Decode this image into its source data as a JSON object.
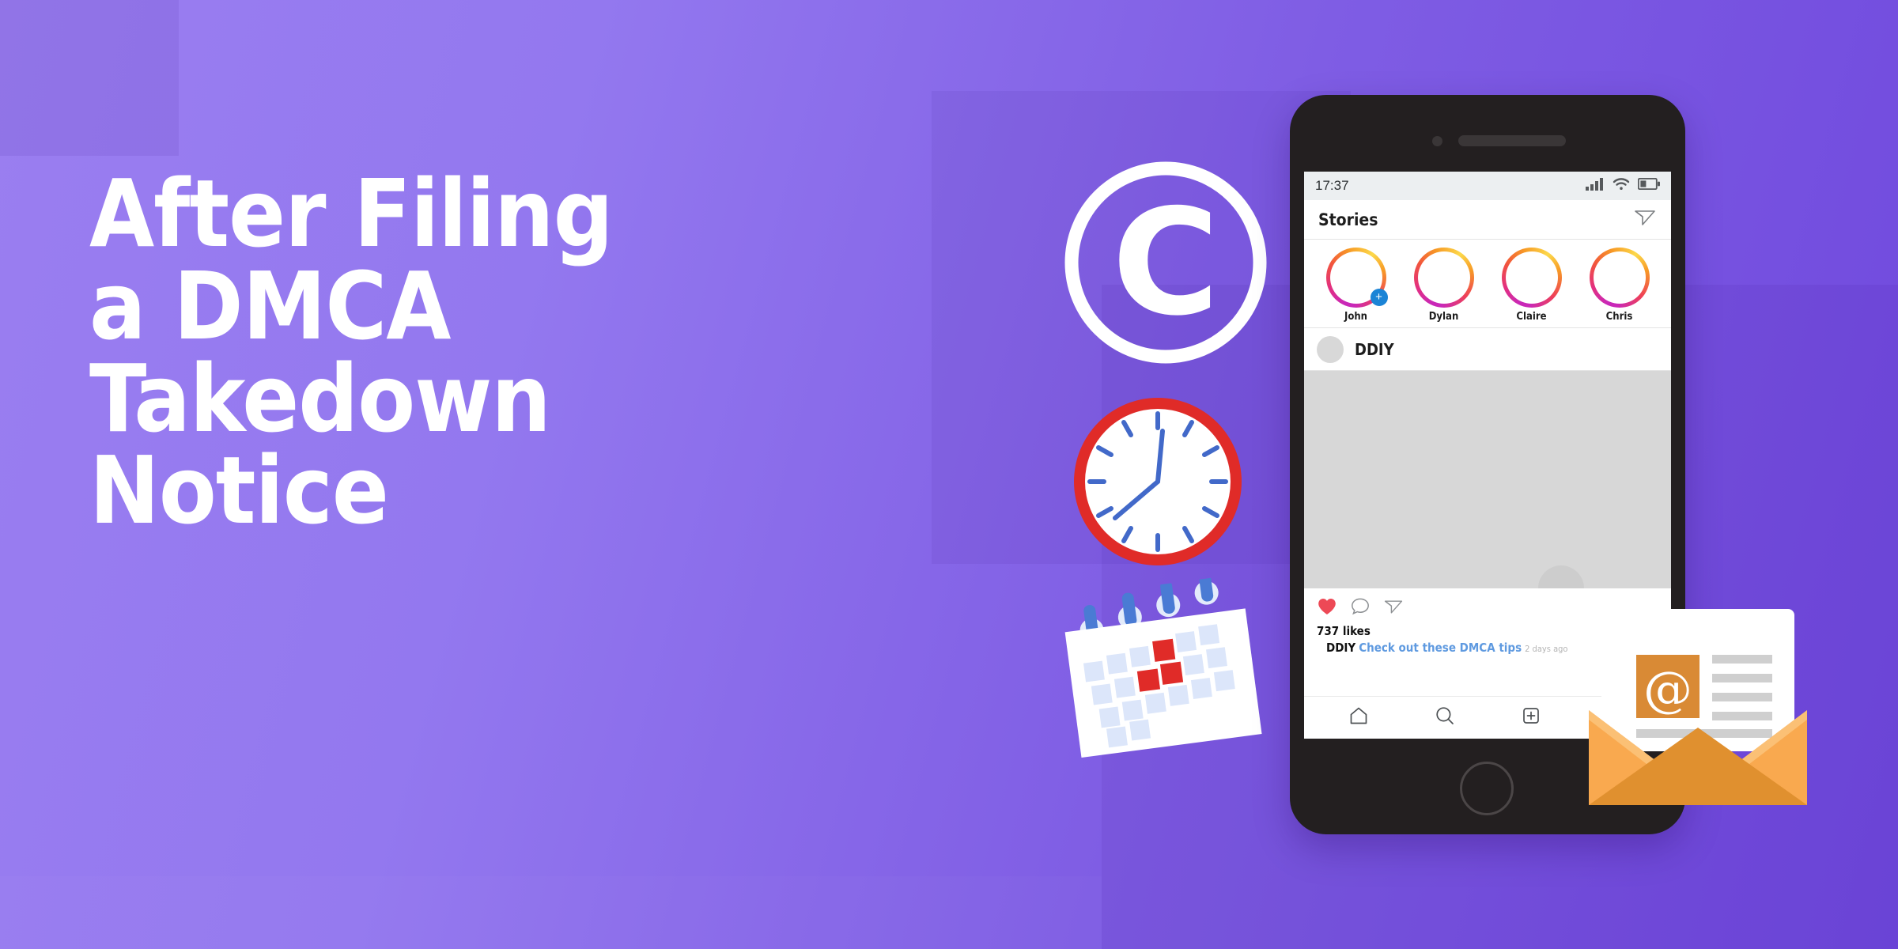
{
  "headline": {
    "lines": [
      "After Filing",
      "a DMCA",
      "Takedown",
      "Notice"
    ],
    "full": "After Filing a DMCA Takedown Notice",
    "color": "#ffffff"
  },
  "background": {
    "gradient_from": "#9a7ef0",
    "gradient_to": "#6f48dd",
    "panel_overlay": "rgba(60,10,140,0.08)"
  },
  "icons": {
    "copyright": {
      "name": "copyright-icon",
      "glyph": "C",
      "color": "#ffffff"
    },
    "clock": {
      "name": "clock-icon",
      "rim_color": "#e02b28",
      "face_color": "#ffffff",
      "hand_color": "#4269c9",
      "time_shown": "7:00"
    },
    "calendar": {
      "name": "calendar-icon",
      "ring_color": "#4a7bd4",
      "cell_color": "#dce6fa",
      "highlight_color": "#e02b28",
      "highlighted_cells": 3,
      "rings": 4,
      "rows": 4,
      "cols": 7
    },
    "envelope": {
      "name": "envelope-icon",
      "body_color": "#f9a94f",
      "flap_color": "#e0902f",
      "letter_color": "#ffffff",
      "at_tile_color": "#d98a35",
      "at_glyph": "@",
      "line_color": "#cfcfcf",
      "text_lines": 6
    }
  },
  "phone": {
    "frame_color": "#231f20",
    "status_bar": {
      "time": "17:37",
      "signal_icon": "signal-bars-icon",
      "wifi_icon": "wifi-icon",
      "battery_icon": "battery-low-icon",
      "battery_level_pct": 35
    },
    "header": {
      "title": "Stories",
      "action_icon": "direct-message-icon"
    },
    "stories": [
      {
        "name": "John",
        "has_add_badge": true
      },
      {
        "name": "Dylan",
        "has_add_badge": false
      },
      {
        "name": "Claire",
        "has_add_badge": false
      },
      {
        "name": "Chris",
        "has_add_badge": false
      }
    ],
    "post": {
      "username": "DDIY",
      "avatar": "avatar-placeholder",
      "actions": [
        "like-icon",
        "comment-icon",
        "share-icon"
      ],
      "liked": true,
      "likes_text": "737 likes",
      "likes_count": 737,
      "caption_user": "DDIY",
      "caption_text": "Check out these DMCA tips",
      "caption_time": "2 days ago",
      "caption_link_color": "#5f9ae0"
    },
    "bottom_nav": [
      {
        "name": "home-icon",
        "active": false
      },
      {
        "name": "search-icon",
        "active": false
      },
      {
        "name": "add-post-icon",
        "active": false
      },
      {
        "name": "activity-heart-icon",
        "active": true
      }
    ]
  }
}
